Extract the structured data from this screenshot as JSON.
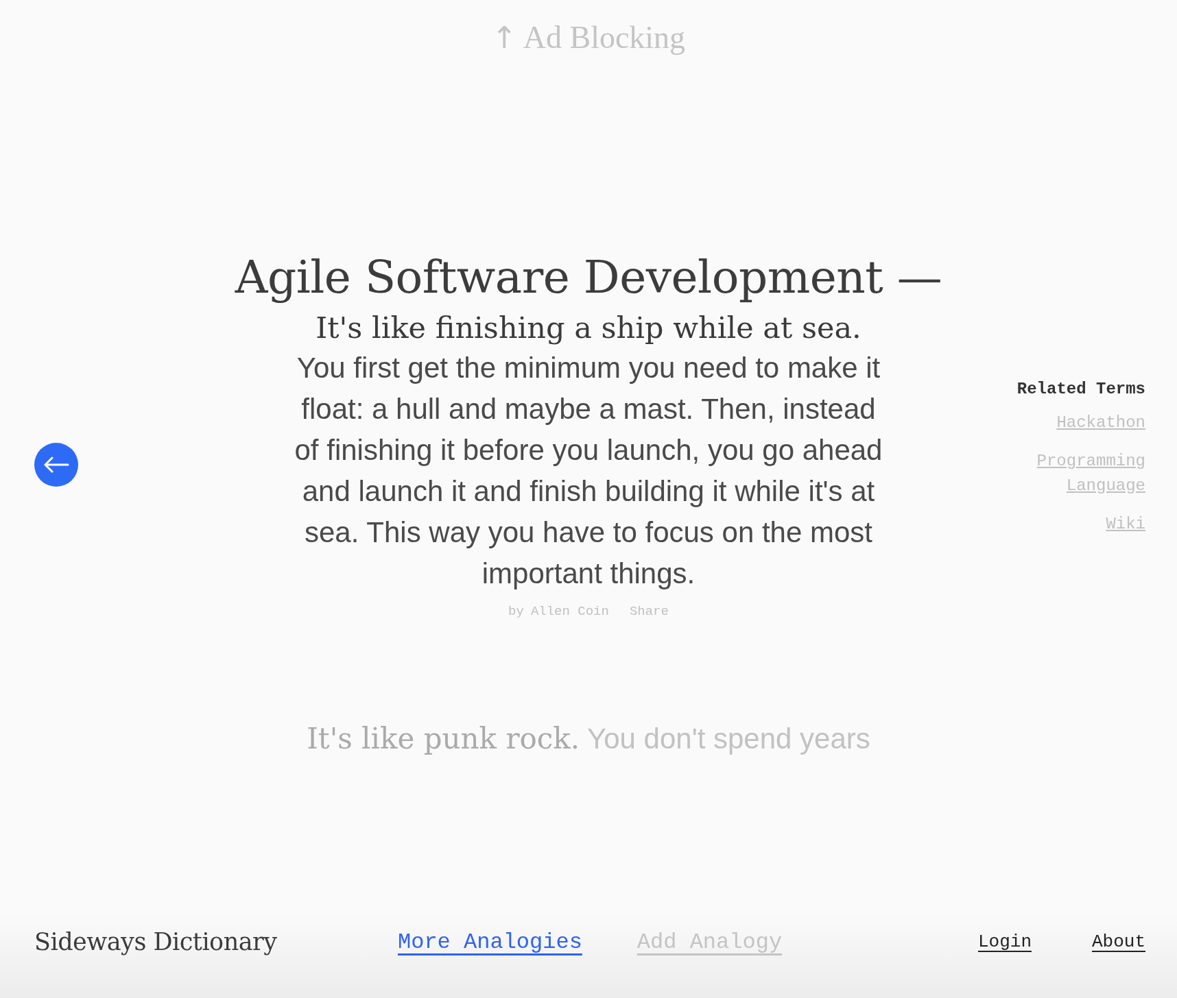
{
  "previous_term": {
    "arrow": "↑",
    "label": "Ad Blocking"
  },
  "term": {
    "title": "Agile Software Development —"
  },
  "analogy": {
    "lead": "It's like finishing a ship while at sea.",
    "body": "You first get the minimum you need to make it float: a hull and maybe a mast. Then, instead of finishing it before you launch, you go ahead and launch it and finish building it while it's at sea. This way you have to focus on the most important things.",
    "by": "by",
    "author": "Allen Coin",
    "share": "Share"
  },
  "next_analogy": {
    "lead": "It's like punk rock.",
    "body": "You don't spend years"
  },
  "related_terms": {
    "title": "Related Terms",
    "items": [
      "Hackathon",
      "Programming Language",
      "Wiki"
    ]
  },
  "footer": {
    "brand": "Sideways Dictionary",
    "actions": [
      {
        "label": "More Analogies",
        "disabled": false
      },
      {
        "label": "Add Analogy",
        "disabled": true
      }
    ],
    "links": [
      "Login",
      "About"
    ]
  }
}
